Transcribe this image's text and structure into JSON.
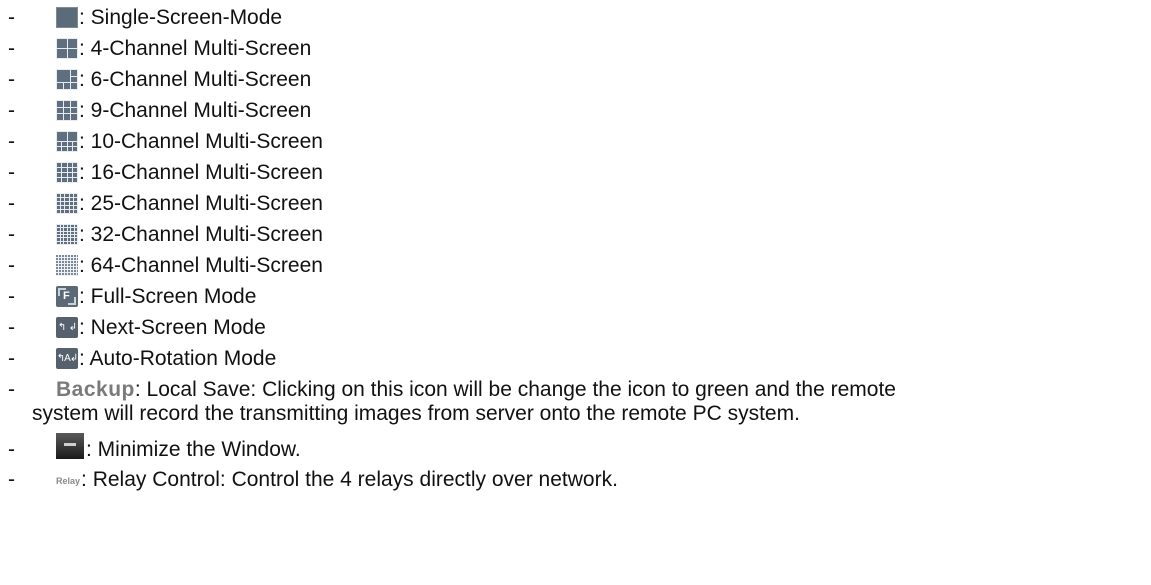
{
  "list": {
    "dash": "-",
    "items": [
      {
        "icon": "single-screen-icon",
        "text": ": Single-Screen-Mode"
      },
      {
        "icon": "four-channel-grid-icon",
        "text": ": 4-Channel Multi-Screen"
      },
      {
        "icon": "six-channel-grid-icon",
        "text": ": 6-Channel Multi-Screen"
      },
      {
        "icon": "nine-channel-grid-icon",
        "text": ": 9-Channel Multi-Screen"
      },
      {
        "icon": "ten-channel-grid-icon",
        "text": ": 10-Channel Multi-Screen"
      },
      {
        "icon": "sixteen-channel-grid-icon",
        "text": ": 16-Channel Multi-Screen"
      },
      {
        "icon": "twenty-five-channel-grid-icon",
        "text": ": 25-Channel Multi-Screen"
      },
      {
        "icon": "thirty-two-channel-grid-icon",
        "text": ": 32-Channel Multi-Screen"
      },
      {
        "icon": "sixty-four-channel-grid-icon",
        "text": " : 64-Channel Multi-Screen"
      },
      {
        "icon": "full-screen-icon",
        "text": ": Full-Screen Mode"
      },
      {
        "icon": "next-screen-icon",
        "text": ": Next-Screen Mode"
      },
      {
        "icon": "auto-rotation-icon",
        "text": ": Auto-Rotation Mode"
      }
    ],
    "backup": {
      "word": "Backup",
      "text_line1": ": Local Save: Clicking on this icon will be change the icon to green and the remote",
      "text_line2": "system will record the transmitting images from server onto the remote PC system."
    },
    "minimize": {
      "icon": "minimize-window-icon",
      "text": ": Minimize the Window."
    },
    "relay": {
      "word": "Relay",
      "text": ": Relay Control: Control the 4 relays directly over network."
    }
  }
}
